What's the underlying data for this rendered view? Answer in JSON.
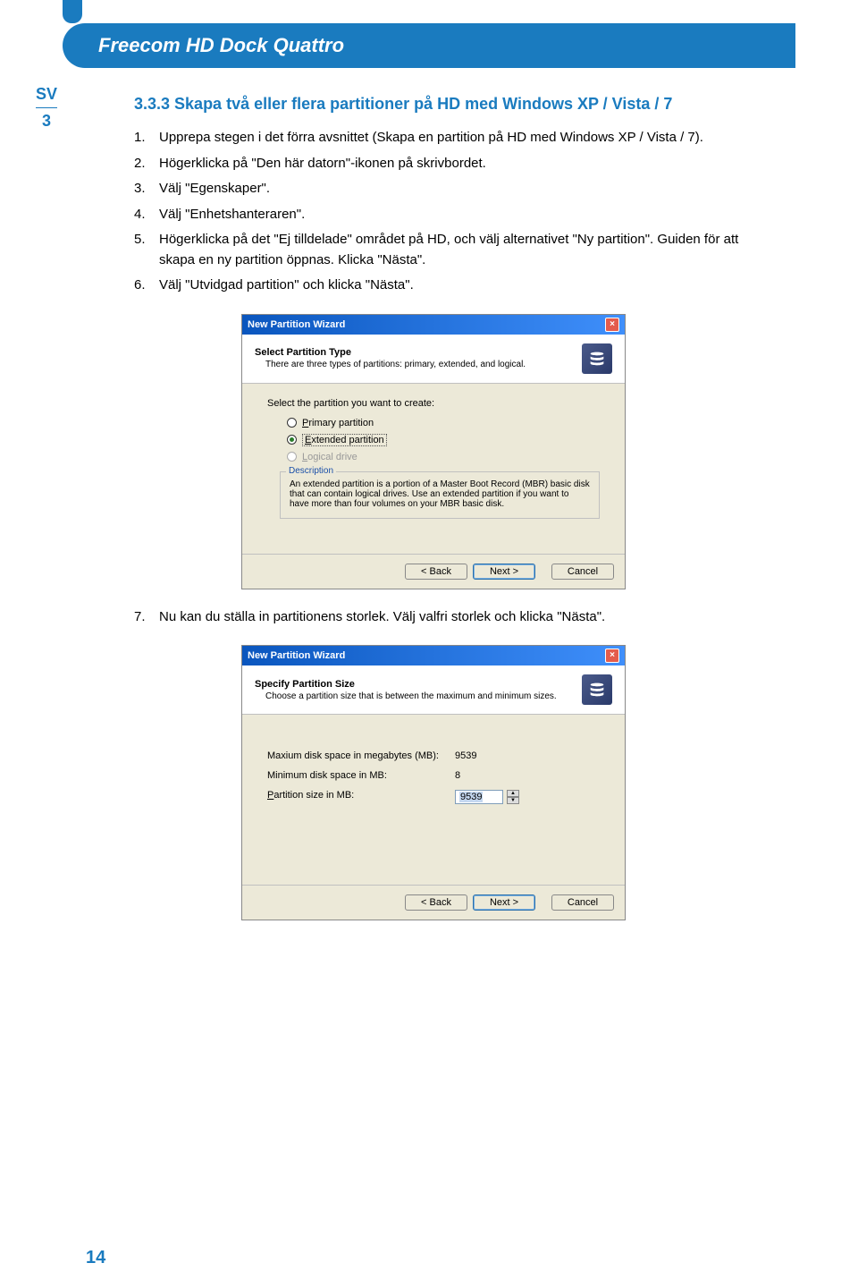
{
  "header": {
    "title": "Freecom HD Dock Quattro"
  },
  "side": {
    "lang": "SV",
    "chapter": "3"
  },
  "section_title": "3.3.3  Skapa två eller flera partitioner på HD med Windows XP / Vista / 7",
  "steps": [
    {
      "num": "1.",
      "text": "Upprepa stegen i det förra avsnittet (Skapa en partition på HD med Windows XP / Vista / 7)."
    },
    {
      "num": "2.",
      "text": "Högerklicka på \"Den här datorn\"-ikonen på skrivbordet."
    },
    {
      "num": "3.",
      "text": "Välj \"Egenskaper\"."
    },
    {
      "num": "4.",
      "text": "Välj \"Enhetshanteraren\"."
    },
    {
      "num": "5.",
      "text": "Högerklicka på det \"Ej tilldelade\" området på HD, och välj alternativet \"Ny partition\". Guiden för att skapa en ny partition öppnas. Klicka \"Nästa\"."
    },
    {
      "num": "6.",
      "text": "Välj \"Utvidgad partition\" och klicka \"Nästa\"."
    }
  ],
  "wizard1": {
    "title": "New Partition Wizard",
    "header_bold": "Select Partition Type",
    "header_sub": "There are three types of partitions: primary, extended, and logical.",
    "lead": "Select the partition you want to create:",
    "opts": {
      "primary": "Primary partition",
      "extended": "Extended partition",
      "logical": "Logical drive"
    },
    "desc_title": "Description",
    "desc_text": "An extended partition is a portion of a Master Boot Record (MBR) basic disk that can contain logical drives. Use an extended partition if you want to have more than four volumes on your MBR basic disk.",
    "back": "< Back",
    "next": "Next >",
    "cancel": "Cancel"
  },
  "step7": {
    "num": "7.",
    "text": "Nu kan du ställa in partitionens storlek. Välj valfri storlek och klicka \"Nästa\"."
  },
  "wizard2": {
    "title": "New Partition Wizard",
    "header_bold": "Specify Partition Size",
    "header_sub": "Choose a partition size that is between the maximum and minimum sizes.",
    "rows": {
      "max_lbl": "Maxium disk space in megabytes (MB):",
      "max_val": "9539",
      "min_lbl": "Minimum disk space in MB:",
      "min_val": "8",
      "size_lbl": "Partition size in MB:",
      "size_val": "9539"
    },
    "back": "< Back",
    "next": "Next >",
    "cancel": "Cancel"
  },
  "page_number": "14"
}
